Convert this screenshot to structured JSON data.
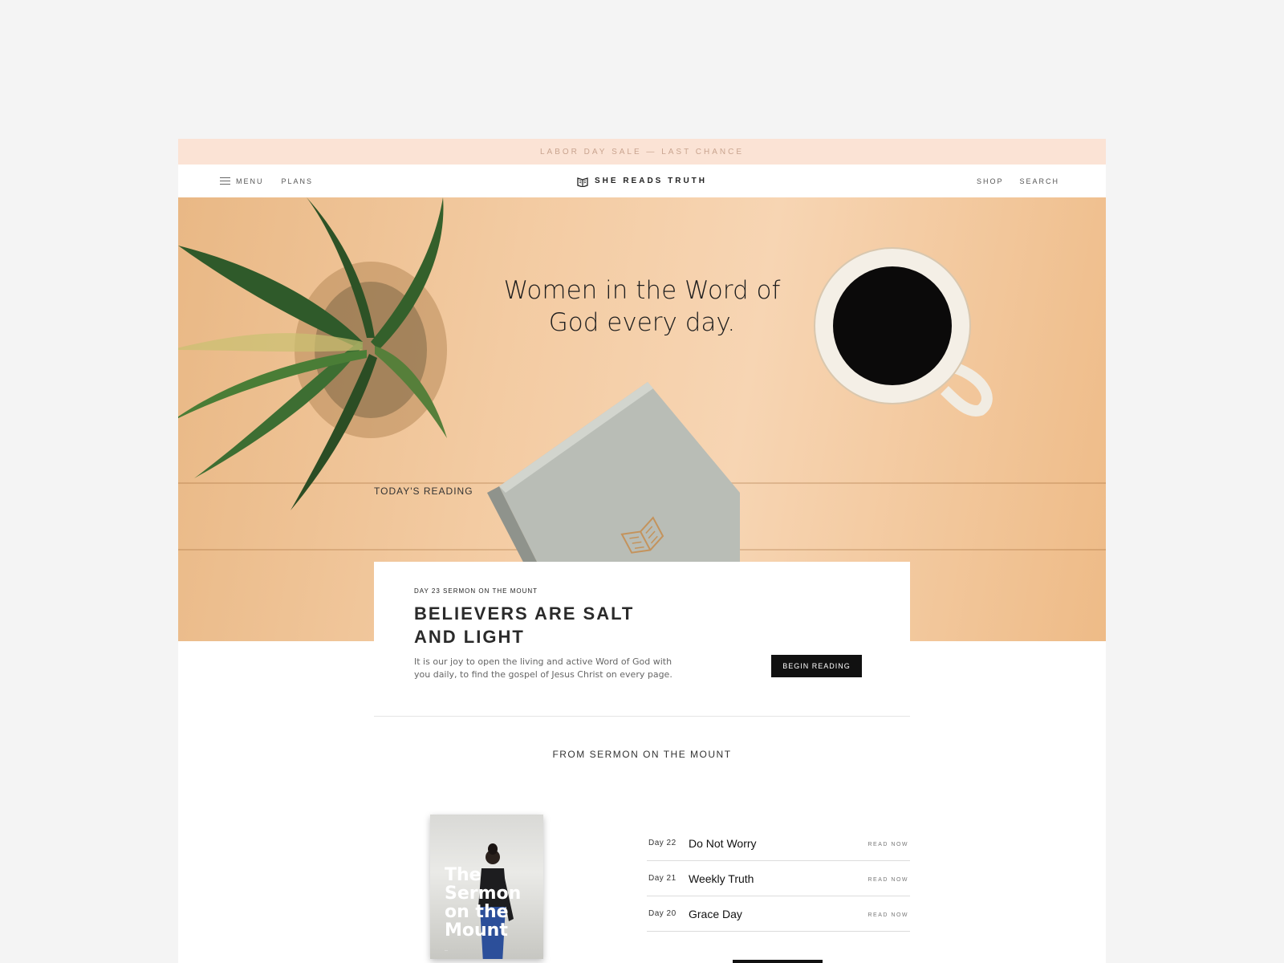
{
  "promo_bar": {
    "text": "LABOR DAY SALE — LAST CHANCE"
  },
  "nav": {
    "menu_label": "MENU",
    "plans_label": "PLANS",
    "brand": "SHE READS TRUTH",
    "shop_label": "SHOP",
    "search_label": "SEARCH"
  },
  "hero": {
    "headline_line1": "Women in the Word of",
    "headline_line2": "God every day."
  },
  "todays_reading": {
    "section_label": "TODAY'S READING",
    "meta": "DAY 23  SERMON ON THE MOUNT",
    "title_line1": "BELIEVERS ARE SALT",
    "title_line2": "AND LIGHT",
    "description": "It is our joy to open the living and active Word of God with you daily, to find the gospel of Jesus Christ on every page.",
    "button_label": "BEGIN READING"
  },
  "plan": {
    "section_title": "FROM SERMON ON THE MOUNT",
    "cover_title": "The\nSermon\non the\nMount",
    "days": [
      {
        "day": "Day 22",
        "title": "Do Not Worry",
        "action": "READ NOW"
      },
      {
        "day": "Day 21",
        "title": "Weekly Truth",
        "action": "READ NOW"
      },
      {
        "day": "Day 20",
        "title": "Grace Day",
        "action": "READ NOW"
      }
    ]
  },
  "colors": {
    "promo_background": "#fbe3d5",
    "promo_text": "#c9a48f",
    "button_background": "#111111",
    "page_background": "#f4f4f4"
  }
}
